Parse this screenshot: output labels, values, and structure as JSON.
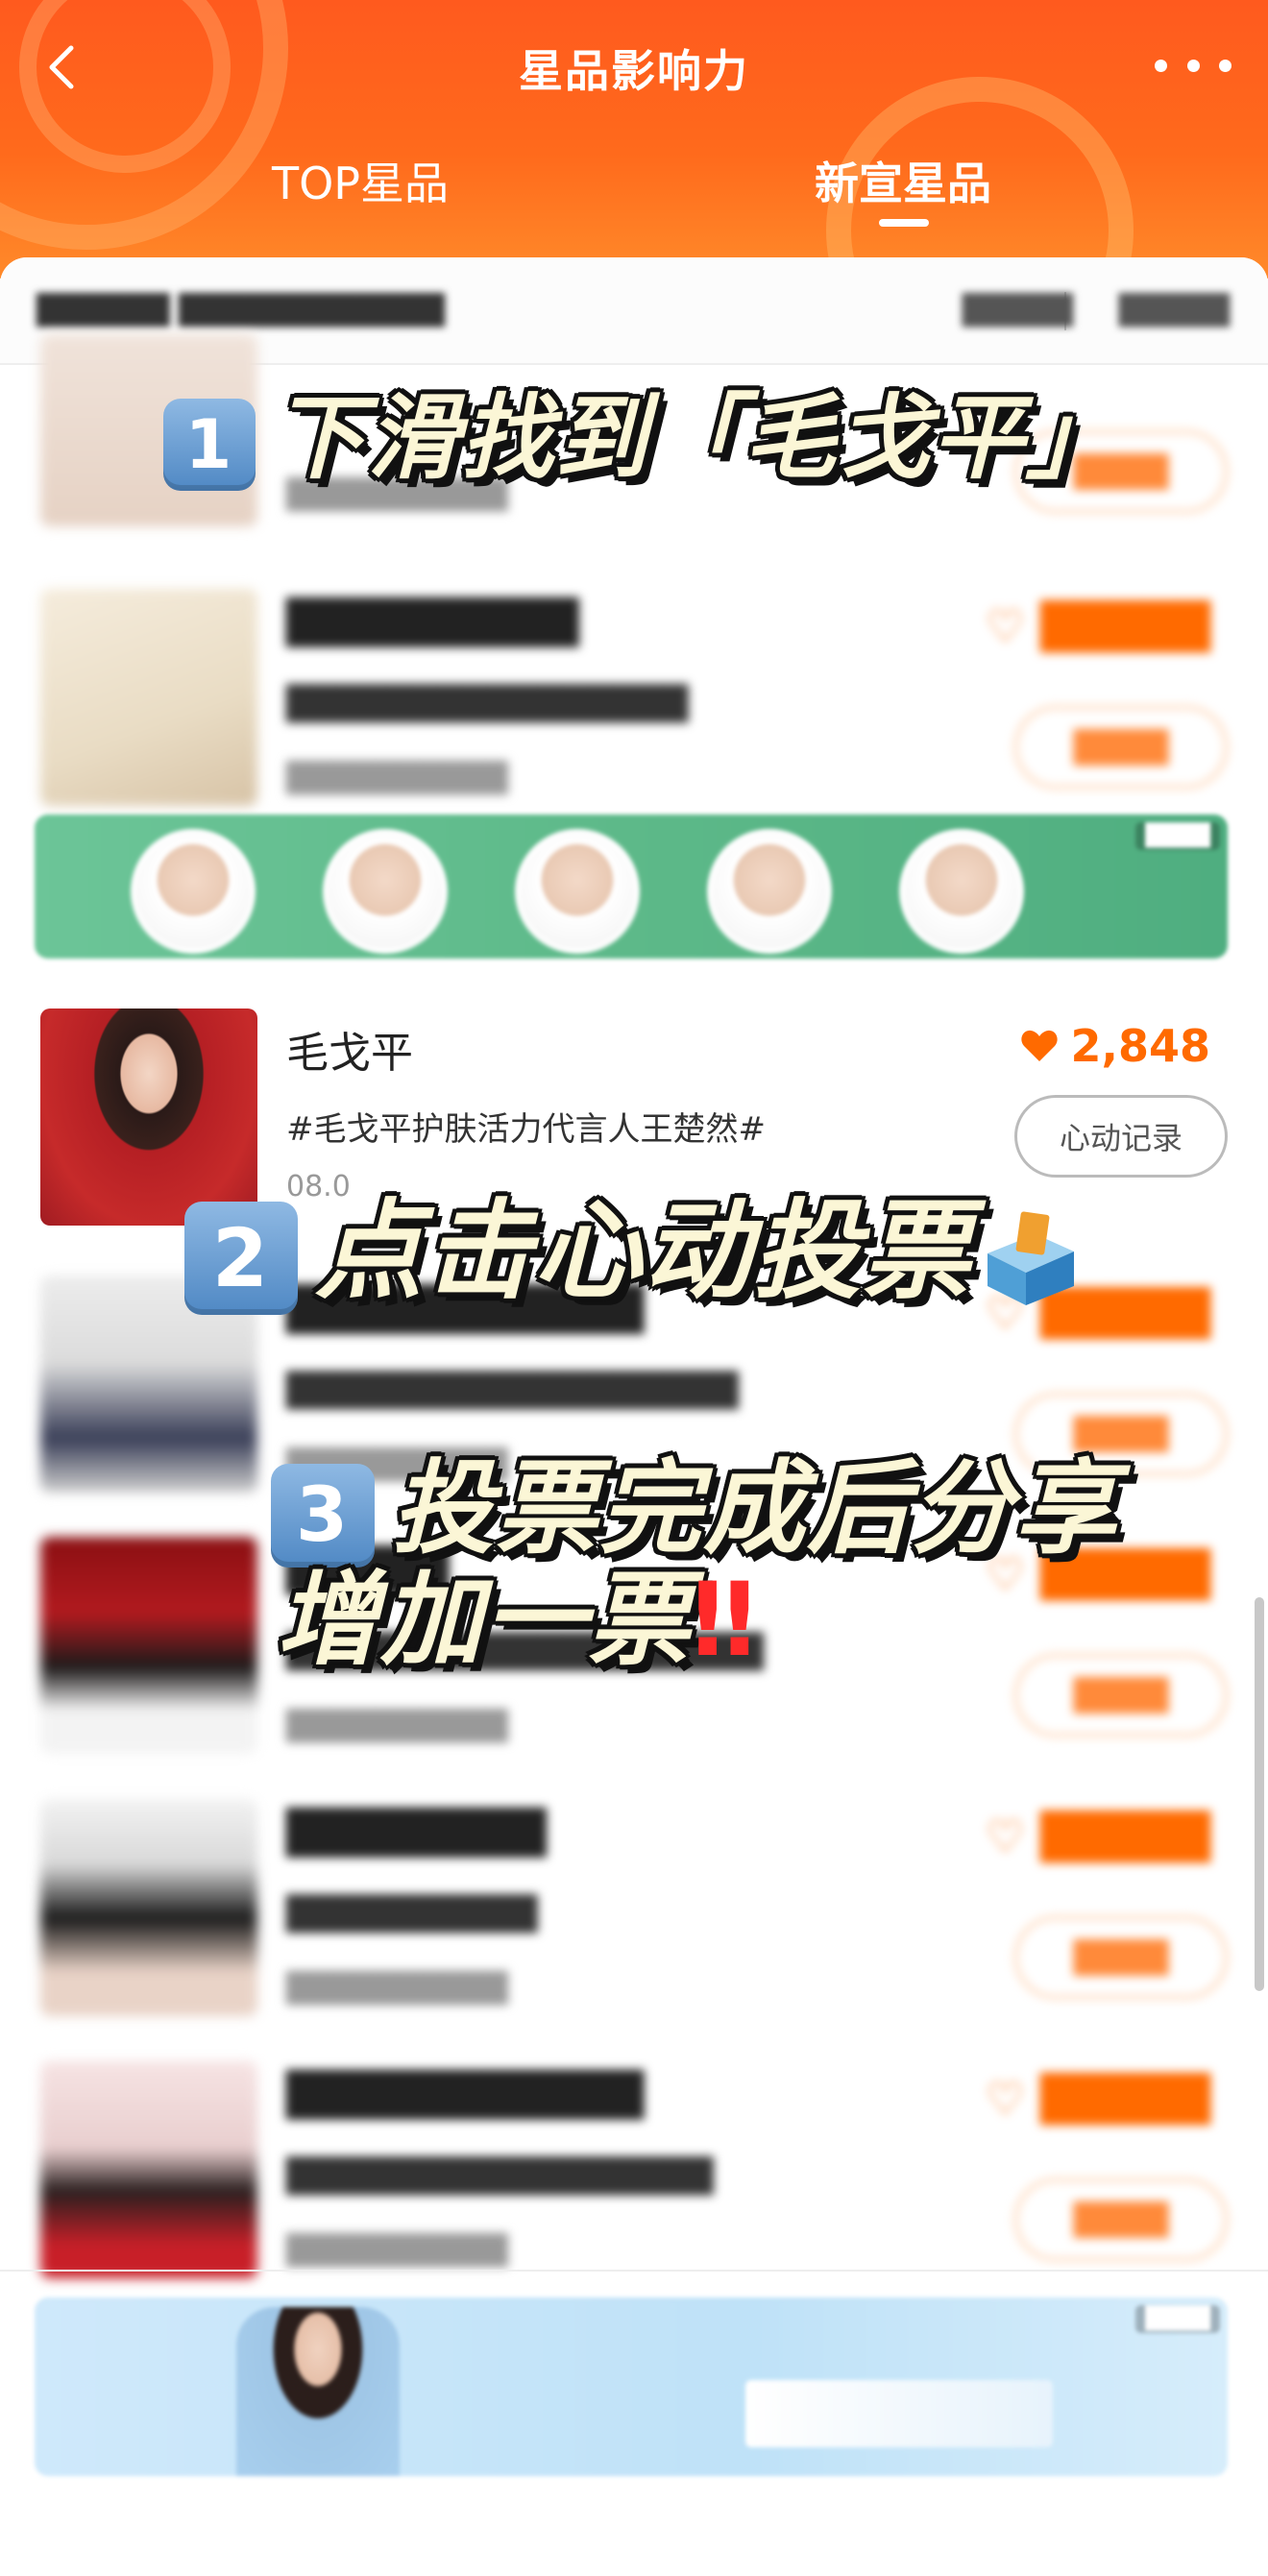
{
  "header": {
    "title": "星品影响力",
    "tabs": [
      {
        "label": "TOP星品",
        "active": false
      },
      {
        "label": "新宣星品",
        "active": true
      }
    ],
    "background_color": "#ff5a1e"
  },
  "focused_item": {
    "name": "毛戈平",
    "tag": "#毛戈平护肤活力代言人王楚然#",
    "votes": "2,848",
    "button_label": "心动记录",
    "date_partial": "08.0"
  },
  "annotations": {
    "step1_num": "1",
    "step1_text": "下滑找到「毛戈平」",
    "step2_num": "2",
    "step2_text": "点击心动投票",
    "step3_num": "3",
    "step3_line1": "投票完成后分享",
    "step3_line2": "增加一票",
    "step3_mark": "‼",
    "text_color": "#fbf6d6"
  },
  "colors": {
    "accent": "#ff6a00",
    "vote_button_border": "#ffc9a0"
  },
  "icons": {
    "back": "chevron-left-icon",
    "more": "more-dots-icon",
    "heart": "heart-icon",
    "ballot": "ballot-box-icon"
  }
}
